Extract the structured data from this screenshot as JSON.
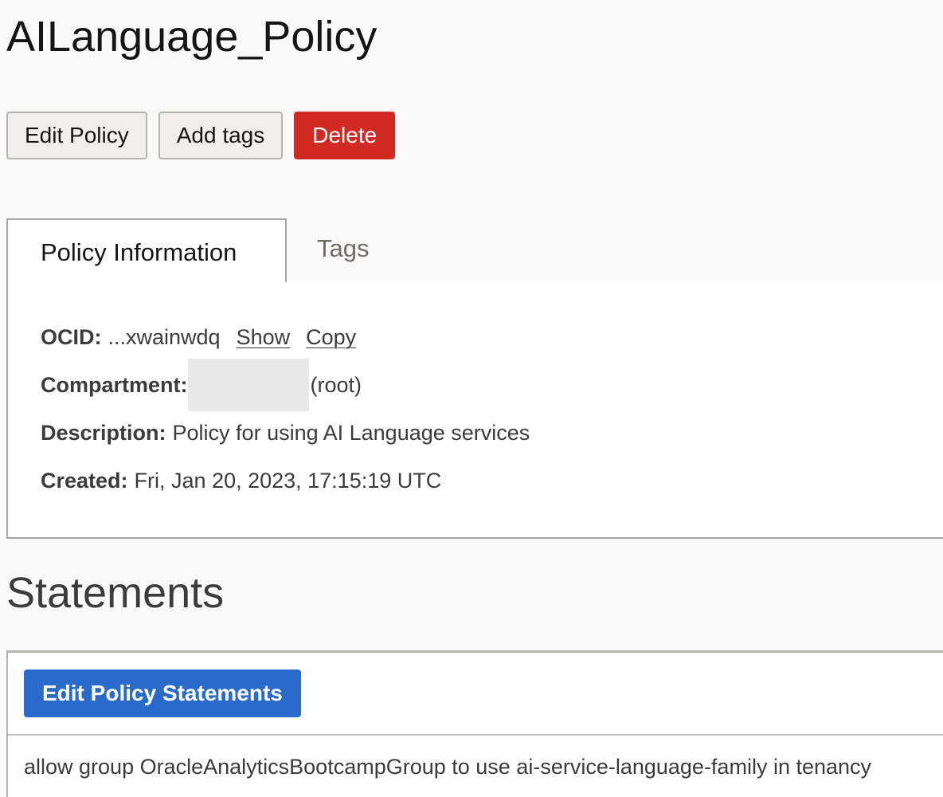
{
  "page": {
    "title": "AILanguage_Policy"
  },
  "actions": {
    "edit_label": "Edit Policy",
    "tags_label": "Add tags",
    "delete_label": "Delete"
  },
  "tabs": [
    {
      "label": "Policy Information",
      "active": true
    },
    {
      "label": "Tags",
      "active": false
    }
  ],
  "info": {
    "ocid_label": "OCID:",
    "ocid_value": "...xwainwdq",
    "show_label": "Show",
    "copy_label": "Copy",
    "compartment_label": "Compartment:",
    "compartment_suffix": "(root)",
    "description_label": "Description:",
    "description_value": "Policy for using AI Language services",
    "created_label": "Created:",
    "created_value": "Fri, Jan 20, 2023, 17:15:19 UTC"
  },
  "statements": {
    "title": "Statements",
    "edit_label": "Edit Policy Statements",
    "items": [
      "allow group OracleAnalyticsBootcampGroup to use ai-service-language-family in tenancy"
    ]
  },
  "colors": {
    "danger": "#d02a22",
    "primary": "#2a6bca",
    "border": "#a8a8a8"
  }
}
